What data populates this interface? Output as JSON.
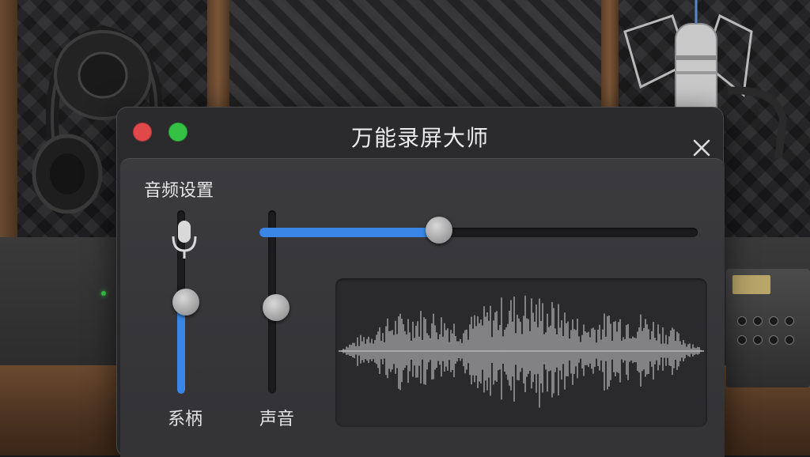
{
  "app": {
    "title": "万能录屏大师"
  },
  "audio_settings": {
    "section_label": "音频设置",
    "system_slider": {
      "label": "系柄",
      "level_percent": 50
    },
    "sound_slider": {
      "label": "声音",
      "level_percent": 47
    },
    "horizontal_slider": {
      "level_percent": 41
    }
  },
  "colors": {
    "accent": "#3a86e6",
    "close_traffic": "#e0484a",
    "maximize_traffic": "#35c244",
    "window_bg": "#2b2b2d"
  },
  "icons": {
    "microphone": "microphone-icon",
    "close": "close-icon"
  }
}
